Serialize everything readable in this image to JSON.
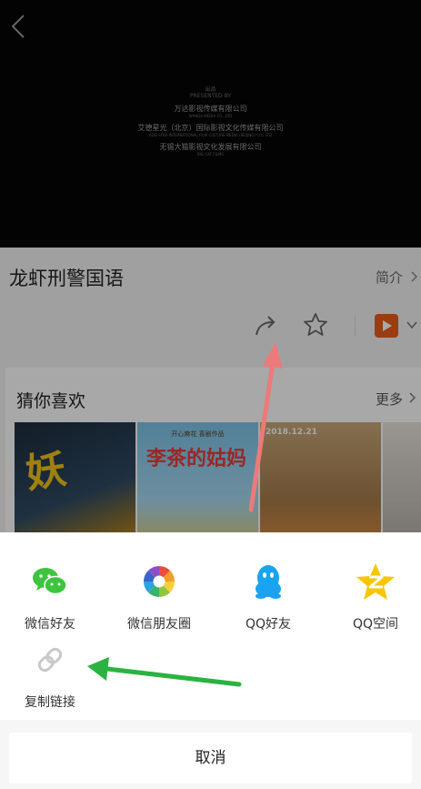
{
  "video": {
    "credits": {
      "heading": "出品",
      "heading_en": "PRESENTED BY",
      "companies": [
        {
          "name": "万达影视传媒有限公司",
          "en": "WANDA MEDIA CO., LTD"
        },
        {
          "name": "艾德星光（北京）国际影视文化传媒有限公司",
          "en": "ADD STAR INTERNATIONAL FILM CULTURE MEDIA (BEIJING) CO., LTD"
        },
        {
          "name": "无锡大猫影视文化发展有限公司",
          "en": "BIG CAT FILMS"
        }
      ]
    }
  },
  "details": {
    "title": "龙虾刑警国语",
    "intro_label": "简介"
  },
  "recommend": {
    "title": "猜你喜欢",
    "more_label": "更多",
    "posters": [
      {
        "text": "妖"
      },
      {
        "caption": "开心麻花 喜剧作品",
        "text": "李茶的姑妈"
      },
      {
        "date": "2018.12.21"
      },
      {}
    ]
  },
  "share": {
    "options": [
      {
        "label": "微信好友",
        "icon": "wechat-icon"
      },
      {
        "label": "微信朋友圈",
        "icon": "moments-icon"
      },
      {
        "label": "QQ好友",
        "icon": "qq-icon"
      },
      {
        "label": "QQ空间",
        "icon": "qzone-icon"
      },
      {
        "label": "复制链接",
        "icon": "link-icon"
      }
    ],
    "cancel_label": "取消"
  },
  "colors": {
    "wechat": "#3dc53d",
    "qq": "#1aa3f0",
    "qzone": "#f7c600",
    "annotation_red": "#ec7a7a",
    "annotation_green": "#2bb241"
  }
}
